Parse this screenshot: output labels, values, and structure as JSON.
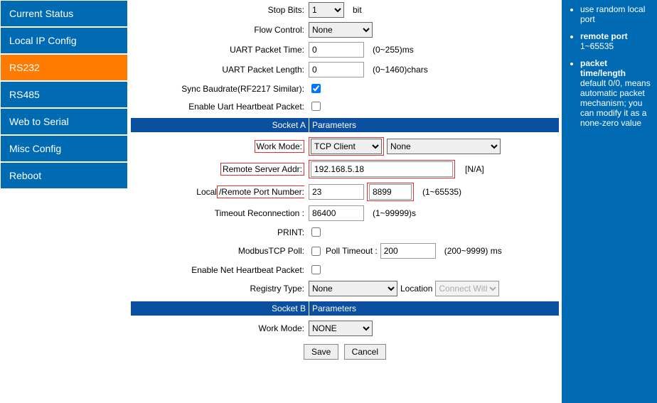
{
  "sidebar": {
    "items": [
      {
        "label": "Current Status"
      },
      {
        "label": "Local IP Config"
      },
      {
        "label": "RS232"
      },
      {
        "label": "RS485"
      },
      {
        "label": "Web to Serial"
      },
      {
        "label": "Misc Config"
      },
      {
        "label": "Reboot"
      }
    ]
  },
  "serial": {
    "stop_bits_label": "Stop Bits:",
    "stop_bits_value": "1",
    "stop_bits_unit": "bit",
    "flow_control_label": "Flow Control:",
    "flow_control_value": "None",
    "uart_pkt_time_label": "UART Packet Time:",
    "uart_pkt_time_value": "0",
    "uart_pkt_time_hint": "(0~255)ms",
    "uart_pkt_len_label": "UART Packet Length:",
    "uart_pkt_len_value": "0",
    "uart_pkt_len_hint": "(0~1460)chars",
    "sync_baud_label": "Sync Baudrate(RF2217 Similar):",
    "uart_heartbeat_label": "Enable Uart Heartbeat Packet:"
  },
  "socket_a": {
    "header_left": "Socket A",
    "header_right": "Parameters",
    "work_mode_label": "Work Mode:",
    "work_mode_value": "TCP Client",
    "work_mode_sub": "None",
    "remote_addr_label": "Remote Server Addr:",
    "remote_addr_value": "192.168.5.18",
    "na": "[N/A]",
    "port_label_local": "Local",
    "port_label_remote": "/Remote Port Number:",
    "local_port_value": "23",
    "remote_port_value": "8899",
    "port_hint": "(1~65535)",
    "timeout_label": "Timeout Reconnection :",
    "timeout_value": "86400",
    "timeout_hint": "(1~99999)s",
    "print_label": "PRINT:",
    "modbus_label": "ModbusTCP Poll:",
    "poll_timeout_label": "Poll Timeout :",
    "poll_timeout_value": "200",
    "poll_timeout_hint": "(200~9999) ms",
    "net_heartbeat_label": "Enable Net Heartbeat Packet:",
    "reg_type_label": "Registry Type:",
    "reg_type_value": "None",
    "location_label": "Location",
    "location_value": "Connect With"
  },
  "socket_b": {
    "header_left": "Socket B",
    "header_right": "Parameters",
    "work_mode_label": "Work Mode:",
    "work_mode_value": "NONE"
  },
  "footer": {
    "save": "Save",
    "cancel": "Cancel"
  },
  "help": {
    "item1_tail": "use random local port",
    "item2_title": "remote port",
    "item2_body": "1~65535",
    "item3_title": "packet time/length",
    "item3_body": "default 0/0, means automatic packet mechanism; you can modify it as a none-zero value"
  }
}
